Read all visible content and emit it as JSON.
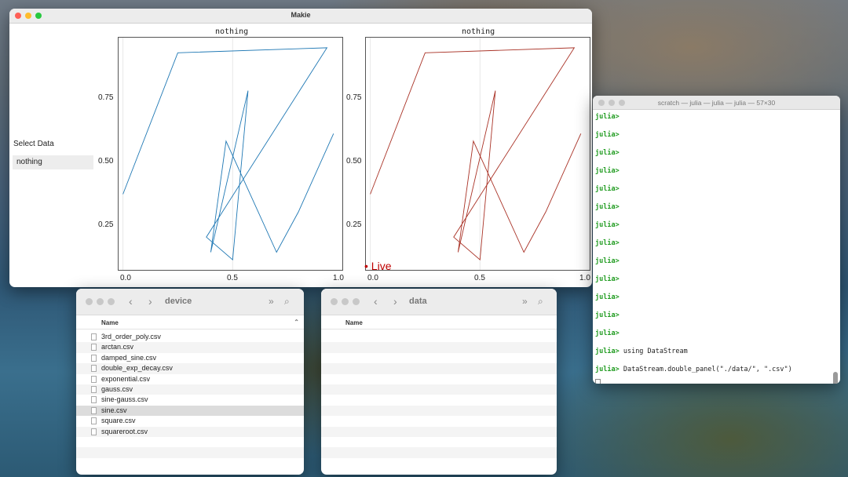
{
  "makie": {
    "title": "Makie",
    "select_label": "Select Data",
    "menu_value": "nothing",
    "live": "• Live",
    "plots": [
      {
        "title": "nothing",
        "color": "#1f78b4"
      },
      {
        "title": "nothing",
        "color": "#a93226"
      }
    ],
    "y_ticks": [
      "0.75",
      "0.50",
      "0.25"
    ],
    "x_ticks": [
      "0.0",
      "0.5",
      "1.0"
    ],
    "chart_data": {
      "type": "line",
      "xlim": [
        -0.02,
        1.0
      ],
      "ylim": [
        0.06,
        0.98
      ],
      "x": [
        0.0,
        0.25,
        0.93,
        0.38,
        0.5,
        0.57,
        0.4,
        0.47,
        0.7,
        0.8,
        0.96
      ],
      "y": [
        0.36,
        0.92,
        0.94,
        0.19,
        0.1,
        0.77,
        0.13,
        0.57,
        0.13,
        0.29,
        0.6
      ]
    }
  },
  "finder_device": {
    "title": "device",
    "column": "Name",
    "files": [
      "3rd_order_poly.csv",
      "arctan.csv",
      "damped_sine.csv",
      "double_exp_decay.csv",
      "exponential.csv",
      "gauss.csv",
      "sine-gauss.csv",
      "sine.csv",
      "square.csv",
      "squareroot.csv"
    ],
    "selected": "sine.csv"
  },
  "finder_data": {
    "title": "data",
    "column": "Name"
  },
  "terminal": {
    "title": "scratch — julia — julia — julia — 57×30",
    "prompt": "julia>",
    "commands": [
      "",
      "",
      "",
      "",
      "",
      "",
      "",
      "",
      "",
      "",
      "",
      "",
      "",
      "using DataStream",
      "DataStream.double_panel(\"./data/\", \".csv\")"
    ]
  },
  "colors": {
    "blue_series": "#1f78b4",
    "red_series": "#a93226",
    "live": "#c00000",
    "prompt": "#1f9b1f"
  }
}
